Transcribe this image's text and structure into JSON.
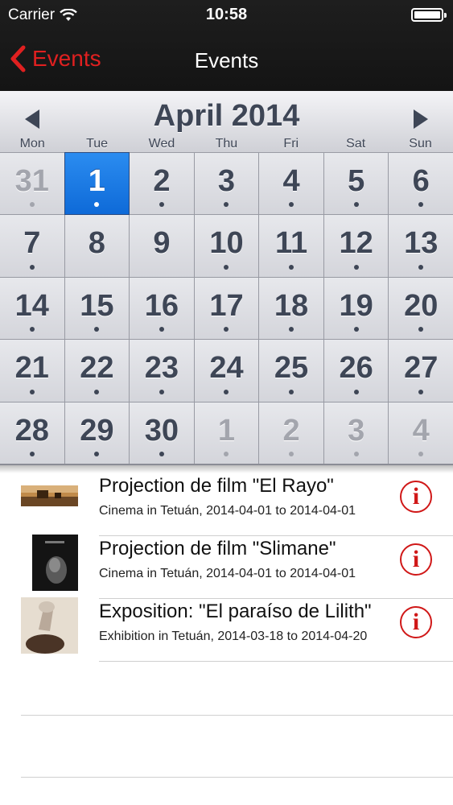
{
  "status": {
    "carrier": "Carrier",
    "time": "10:58"
  },
  "nav": {
    "back_label": "Events",
    "title": "Events"
  },
  "calendar": {
    "month_label": "April 2014",
    "weekdays": [
      "Mon",
      "Tue",
      "Wed",
      "Thu",
      "Fri",
      "Sat",
      "Sun"
    ],
    "days": [
      {
        "n": "31",
        "other": true,
        "dot": true
      },
      {
        "n": "1",
        "selected": true,
        "dot": true
      },
      {
        "n": "2",
        "dot": true
      },
      {
        "n": "3",
        "dot": true
      },
      {
        "n": "4",
        "dot": true
      },
      {
        "n": "5",
        "dot": true
      },
      {
        "n": "6",
        "dot": true
      },
      {
        "n": "7",
        "dot": true
      },
      {
        "n": "8",
        "dot": false
      },
      {
        "n": "9",
        "dot": false
      },
      {
        "n": "10",
        "dot": true
      },
      {
        "n": "11",
        "dot": true
      },
      {
        "n": "12",
        "dot": true
      },
      {
        "n": "13",
        "dot": true
      },
      {
        "n": "14",
        "dot": true
      },
      {
        "n": "15",
        "dot": true
      },
      {
        "n": "16",
        "dot": true
      },
      {
        "n": "17",
        "dot": true
      },
      {
        "n": "18",
        "dot": true
      },
      {
        "n": "19",
        "dot": true
      },
      {
        "n": "20",
        "dot": true
      },
      {
        "n": "21",
        "dot": true
      },
      {
        "n": "22",
        "dot": true
      },
      {
        "n": "23",
        "dot": true
      },
      {
        "n": "24",
        "dot": true
      },
      {
        "n": "25",
        "dot": true
      },
      {
        "n": "26",
        "dot": true
      },
      {
        "n": "27",
        "dot": true
      },
      {
        "n": "28",
        "dot": true
      },
      {
        "n": "29",
        "dot": true
      },
      {
        "n": "30",
        "dot": true
      },
      {
        "n": "1",
        "other": true,
        "dot": true
      },
      {
        "n": "2",
        "other": true,
        "dot": true
      },
      {
        "n": "3",
        "other": true,
        "dot": true
      },
      {
        "n": "4",
        "other": true,
        "dot": true
      }
    ]
  },
  "events": [
    {
      "title": "Projection de film \"El Rayo\"",
      "subtitle": "Cinema in Tetuán, 2014-04-01 to 2014-04-01",
      "thumb": "film-still"
    },
    {
      "title": "Projection de film \"Slimane\"",
      "subtitle": "Cinema in Tetuán, 2014-04-01 to 2014-04-01",
      "thumb": "film-poster"
    },
    {
      "title": "Exposition: \"El paraíso de Lilith\"",
      "subtitle": "Exhibition in Tetuán, 2014-03-18 to 2014-04-20",
      "thumb": "artwork"
    }
  ],
  "info_icon": "i",
  "colors": {
    "accent": "#e02020",
    "selected": "#1673e0",
    "navbar": "#181818"
  }
}
